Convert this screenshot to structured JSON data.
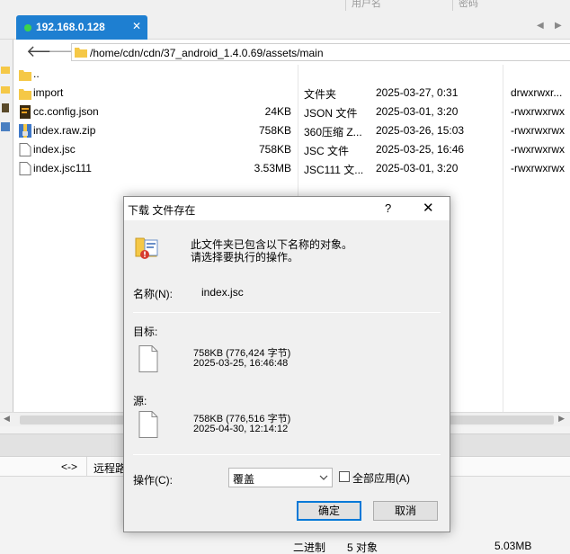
{
  "top_headers": [
    "用户名",
    "密码"
  ],
  "tab": {
    "title": "192.168.0.128",
    "close_glyph": "✕",
    "left_arrow": "◀",
    "right_arrow": "▶"
  },
  "address_bar": {
    "path": "/home/cdn/cdn/37_android_1.4.0.69/assets/main",
    "back_glyph": "🡐",
    "forward_glyph": "🡒"
  },
  "files": [
    {
      "name": "..",
      "size": "",
      "type": "",
      "date": "",
      "perm": "",
      "icon": "folder-icon"
    },
    {
      "name": "import",
      "size": "",
      "type": "文件夹",
      "date": "2025-03-27, 0:31",
      "perm": "drwxrwxr...",
      "icon": "folder-icon"
    },
    {
      "name": "cc.config.json",
      "size": "24KB",
      "type": "JSON 文件",
      "date": "2025-03-01, 3:20",
      "perm": "-rwxrwxrwx",
      "icon": "json-file-icon"
    },
    {
      "name": "index.raw.zip",
      "size": "758KB",
      "type": "360压缩 Z...",
      "date": "2025-03-26, 15:03",
      "perm": "-rwxrwxrwx",
      "icon": "zip-file-icon"
    },
    {
      "name": "index.jsc",
      "size": "758KB",
      "type": "JSC 文件",
      "date": "2025-03-25, 16:46",
      "perm": "-rwxrwxrwx",
      "icon": "file-icon"
    },
    {
      "name": "index.jsc111",
      "size": "3.53MB",
      "type": "JSC111 文...",
      "date": "2025-03-01, 3:20",
      "perm": "-rwxrwxrwx",
      "icon": "file-icon"
    }
  ],
  "transfer_panel": {
    "direction_label": "<->",
    "remote_label": "远程路"
  },
  "status_bar": {
    "mode": "二进制",
    "count": "5 对象",
    "size": "5.03MB"
  },
  "dialog": {
    "title": "下载 文件存在",
    "help_glyph": "?",
    "close_glyph": "✕",
    "message_line1": "此文件夹已包含以下名称的对象。",
    "message_line2": "请选择要执行的操作。",
    "name_label": "名称(N):",
    "name_value": "index.jsc",
    "target_label": "目标:",
    "target_size": "758KB (776,424 字节)",
    "target_date": "2025-03-25, 16:46:48",
    "source_label": "源:",
    "source_size": "758KB (776,516 字节)",
    "source_date": "2025-04-30, 12:14:12",
    "action_label": "操作(C):",
    "action_value": "覆盖",
    "apply_all_label": "全部应用(A)",
    "apply_all_checked": false,
    "ok_label": "确定",
    "cancel_label": "取消"
  },
  "colors": {
    "tab_active": "#1e7fd1",
    "status_dot": "#3dd44a",
    "folder": "#f5c847",
    "default_button_border": "#0078d7"
  }
}
